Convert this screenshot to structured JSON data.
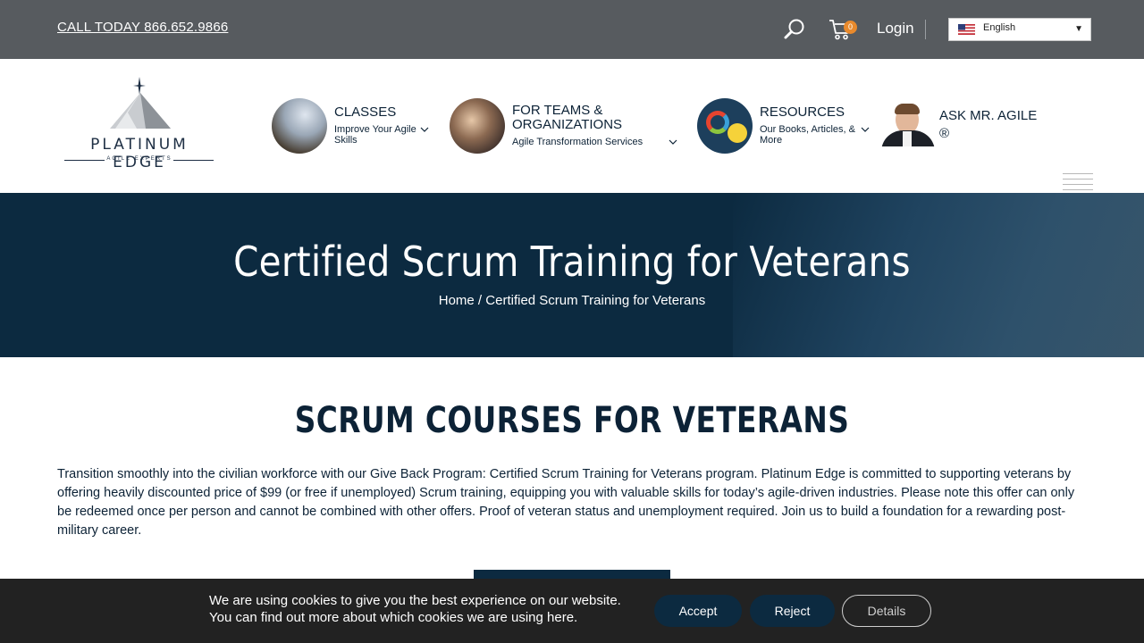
{
  "topbar": {
    "call_text": "CALL TODAY 866.652.9866",
    "cart_count": "0",
    "login_label": "Login",
    "language": "English"
  },
  "logo": {
    "name": "PLATINUM EDGE",
    "tagline": "AGILE EXPERTS"
  },
  "nav": [
    {
      "title": "CLASSES",
      "subtitle": "Improve Your Agile Skills"
    },
    {
      "title": "FOR TEAMS & ORGANIZATIONS",
      "subtitle": "Agile Transformation Services"
    },
    {
      "title": "RESOURCES",
      "subtitle": "Our Books, Articles, & More"
    },
    {
      "title": "ASK MR. AGILE ®",
      "subtitle": ""
    }
  ],
  "hero": {
    "title": "Certified Scrum Training for Veterans",
    "breadcrumb_home": "Home",
    "breadcrumb_sep": " / ",
    "breadcrumb_current": "Certified Scrum Training for Veterans"
  },
  "main": {
    "heading": "SCRUM COURSES FOR VETERANS",
    "paragraph": "Transition smoothly into the civilian workforce with our Give Back Program: Certified Scrum Training for Veterans program. Platinum Edge is committed to supporting veterans by offering heavily discounted price of $99 (or free if unemployed) Scrum training, equipping you with valuable skills for today’s agile-driven industries. Please note this offer can only be redeemed once per person and cannot be combined with other offers. Proof of veteran status and unemployment required. Join us to build a foundation for a rewarding post-military career."
  },
  "cookie": {
    "line1": "We are using cookies to give you the best experience on our website.",
    "line2_prefix": "You can find out more about which cookies we are using ",
    "line2_link": "here",
    "line2_suffix": ".",
    "accept": "Accept",
    "reject": "Reject",
    "details": "Details"
  },
  "colors": {
    "topbar": "#575b5f",
    "navy": "#0c2a40",
    "badge": "#e98a2c",
    "cookie_bg": "#222222"
  }
}
